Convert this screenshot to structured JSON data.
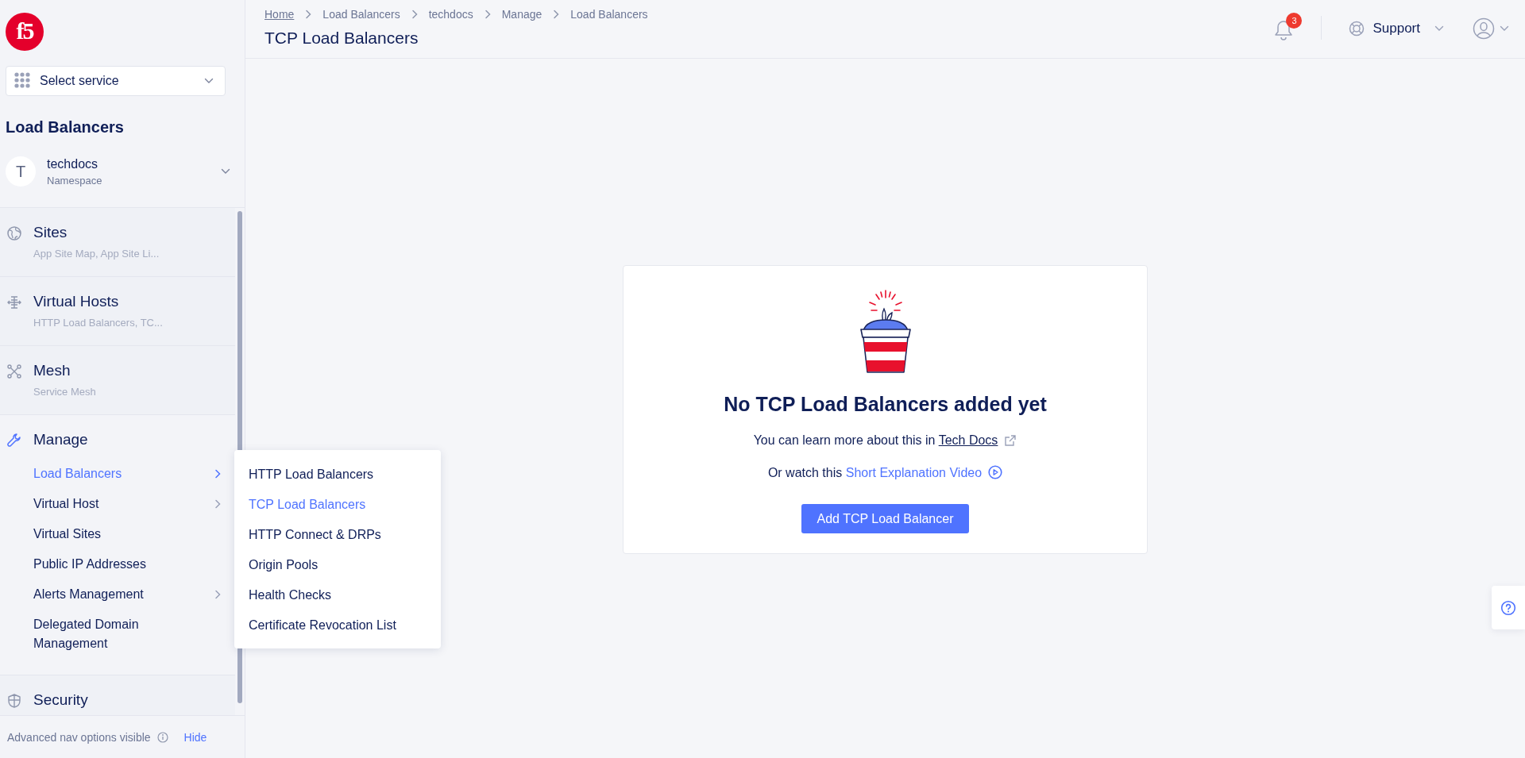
{
  "logo": {
    "text": "f5"
  },
  "service_select": {
    "label": "Select service"
  },
  "section_title": "Load Balancers",
  "namespace": {
    "avatar": "T",
    "name": "techdocs",
    "caption": "Namespace"
  },
  "nav_groups": [
    {
      "title": "Sites",
      "subtitle": "App Site Map, App Site Li..."
    },
    {
      "title": "Virtual Hosts",
      "subtitle": "HTTP Load Balancers, TC..."
    },
    {
      "title": "Mesh",
      "subtitle": "Service Mesh"
    },
    {
      "title": "Manage",
      "expanded": true,
      "items": [
        {
          "label": "Load Balancers",
          "selected": true,
          "has_submenu": true
        },
        {
          "label": "Virtual Host",
          "selected": false,
          "has_submenu": true
        },
        {
          "label": "Virtual Sites",
          "selected": false,
          "has_submenu": false
        },
        {
          "label": "Public IP Addresses",
          "selected": false,
          "has_submenu": false
        },
        {
          "label": "Alerts Management",
          "selected": false,
          "has_submenu": true
        },
        {
          "label": "Delegated Domain Management",
          "selected": false,
          "has_submenu": false
        }
      ]
    },
    {
      "title": "Security"
    }
  ],
  "footer": {
    "text": "Advanced nav options visible",
    "link": "Hide"
  },
  "submenu": [
    {
      "label": "HTTP Load Balancers",
      "selected": false
    },
    {
      "label": "TCP Load Balancers",
      "selected": true
    },
    {
      "label": "HTTP Connect & DRPs",
      "selected": false
    },
    {
      "label": "Origin Pools",
      "selected": false
    },
    {
      "label": "Health Checks",
      "selected": false
    },
    {
      "label": "Certificate Revocation List",
      "selected": false
    }
  ],
  "breadcrumbs": [
    {
      "label": "Home",
      "link": true
    },
    {
      "label": "Load Balancers",
      "link": false
    },
    {
      "label": "techdocs",
      "link": false
    },
    {
      "label": "Manage",
      "link": false
    },
    {
      "label": "Load Balancers",
      "link": false
    }
  ],
  "page_title": "TCP Load Balancers",
  "notifications": {
    "count": "3"
  },
  "support": {
    "label": "Support"
  },
  "empty_state": {
    "title": "No TCP Load Balancers added yet",
    "docs_text": "You can learn more about this in",
    "docs_link": "Tech Docs",
    "video_text": "Or watch this",
    "video_link": "Short Explanation Video",
    "button": "Add TCP Load Balancer"
  }
}
